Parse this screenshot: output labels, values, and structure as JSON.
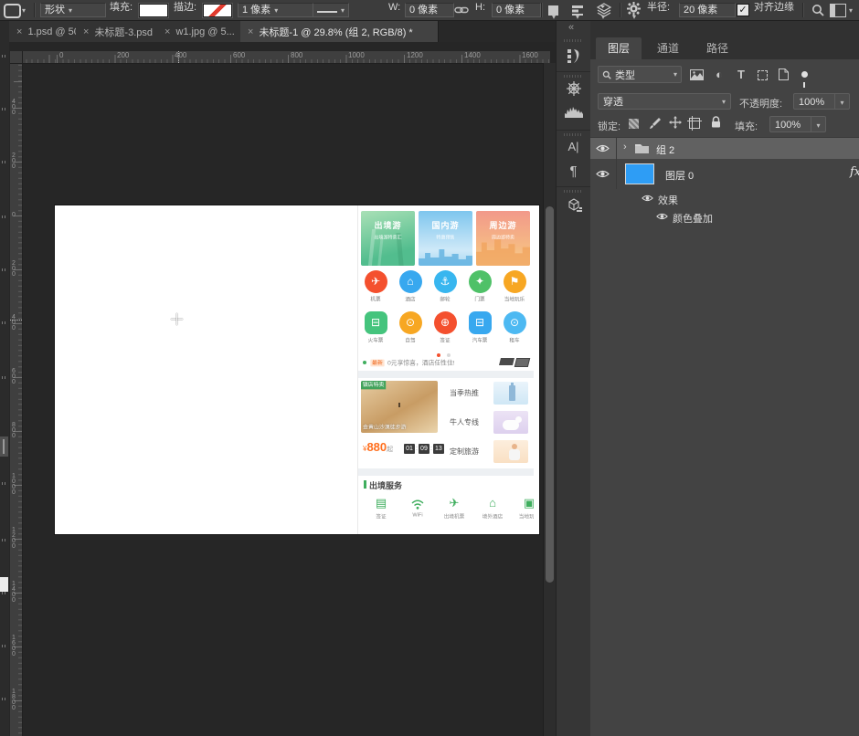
{
  "options_bar": {
    "tool": "形状",
    "fill_label": "填充:",
    "stroke_label": "描边:",
    "stroke_size": "1 像素",
    "w_label": "W:",
    "w_value": "0 像素",
    "h_label": "H:",
    "h_value": "0 像素",
    "radius_label": "半径:",
    "radius_value": "20 像素",
    "align_edges": "对齐边缘"
  },
  "doc_tabs": [
    {
      "label": "1.psd @ 50..."
    },
    {
      "label": "未标题-3.psd"
    },
    {
      "label": "w1.jpg @ 5..."
    },
    {
      "label": "未标题-1 @ 29.8% (组 2, RGB/8) *"
    }
  ],
  "rulers": {
    "top": [
      "0",
      "200",
      "400",
      "600",
      "800",
      "1000",
      "1200",
      "1400",
      "1600"
    ],
    "left": [
      "600",
      "400",
      "200",
      "0",
      "200",
      "400",
      "600",
      "800",
      "1000",
      "1200",
      "1400",
      "1600",
      "1800"
    ]
  },
  "dock": {
    "character_glyph": "A|",
    "paragraph_glyph": "¶",
    "collapse_glyph": "«"
  },
  "layers_panel": {
    "tabs": [
      "图层",
      "通道",
      "路径"
    ],
    "filter_type": "类型",
    "blend_mode": "穿透",
    "opacity_label": "不透明度:",
    "opacity": "100%",
    "lock_label": "锁定:",
    "fill_label": "填充:",
    "fill": "100%",
    "rows": {
      "group": "组 2",
      "layer": "图层 0",
      "effects": "效果",
      "overlay": "颜色叠加",
      "fx": "fx"
    }
  },
  "app_design": {
    "banners": [
      {
        "title": "出境游",
        "subtitle": "出境游特卖汇"
      },
      {
        "title": "国内游",
        "subtitle": "特惠预售"
      },
      {
        "title": "周边游",
        "subtitle": "周边游特卖"
      }
    ],
    "services_row1": [
      {
        "label": "机票",
        "glyph": "✈",
        "color": "#f4502e"
      },
      {
        "label": "酒店",
        "glyph": "⌂",
        "color": "#38a8ef"
      },
      {
        "label": "邮轮",
        "glyph": "⚓",
        "color": "#38b6ef"
      },
      {
        "label": "门票",
        "glyph": "✦",
        "color": "#4fc168"
      },
      {
        "label": "当地玩乐",
        "glyph": "⚑",
        "color": "#f7a723"
      }
    ],
    "services_row2": [
      {
        "label": "火车票",
        "glyph": "⊟",
        "color": "#45c47d"
      },
      {
        "label": "自驾",
        "glyph": "⊙",
        "color": "#f7a723"
      },
      {
        "label": "签证",
        "glyph": "⊕",
        "color": "#f4502e"
      },
      {
        "label": "汽车票",
        "glyph": "⊟",
        "color": "#38a8ef"
      },
      {
        "label": "租车",
        "glyph": "⊙",
        "color": "#4db9f2"
      }
    ],
    "notice": {
      "badge": "最新",
      "text": "0元享惊喜，酒店任性住!"
    },
    "promo": {
      "badge": "镇店特卖",
      "caption": "金黄山沙漠徒步游",
      "currency": "¥",
      "price": "880",
      "suffix": "起",
      "countdown": [
        "01",
        "09",
        "13"
      ],
      "links": [
        "当季热推",
        "牛人专线",
        "定制旅游"
      ]
    },
    "outbound": {
      "title": "出境服务",
      "items": [
        {
          "label": "签证",
          "glyph": "▤"
        },
        {
          "label": "WiFi",
          "glyph": ""
        },
        {
          "label": "出境机票",
          "glyph": "✈"
        },
        {
          "label": "境外酒店",
          "glyph": "⌂"
        },
        {
          "label": "当地玩乐",
          "glyph": "▣"
        }
      ]
    }
  },
  "colors": {
    "layer_thumb": "#2e9df5",
    "price_orange": "#ff6f1e",
    "app_green": "#3fae5e",
    "banner_green": "#52bd8e",
    "banner_blue": "#7ec6ee",
    "banner_coral": "#f2998a"
  }
}
